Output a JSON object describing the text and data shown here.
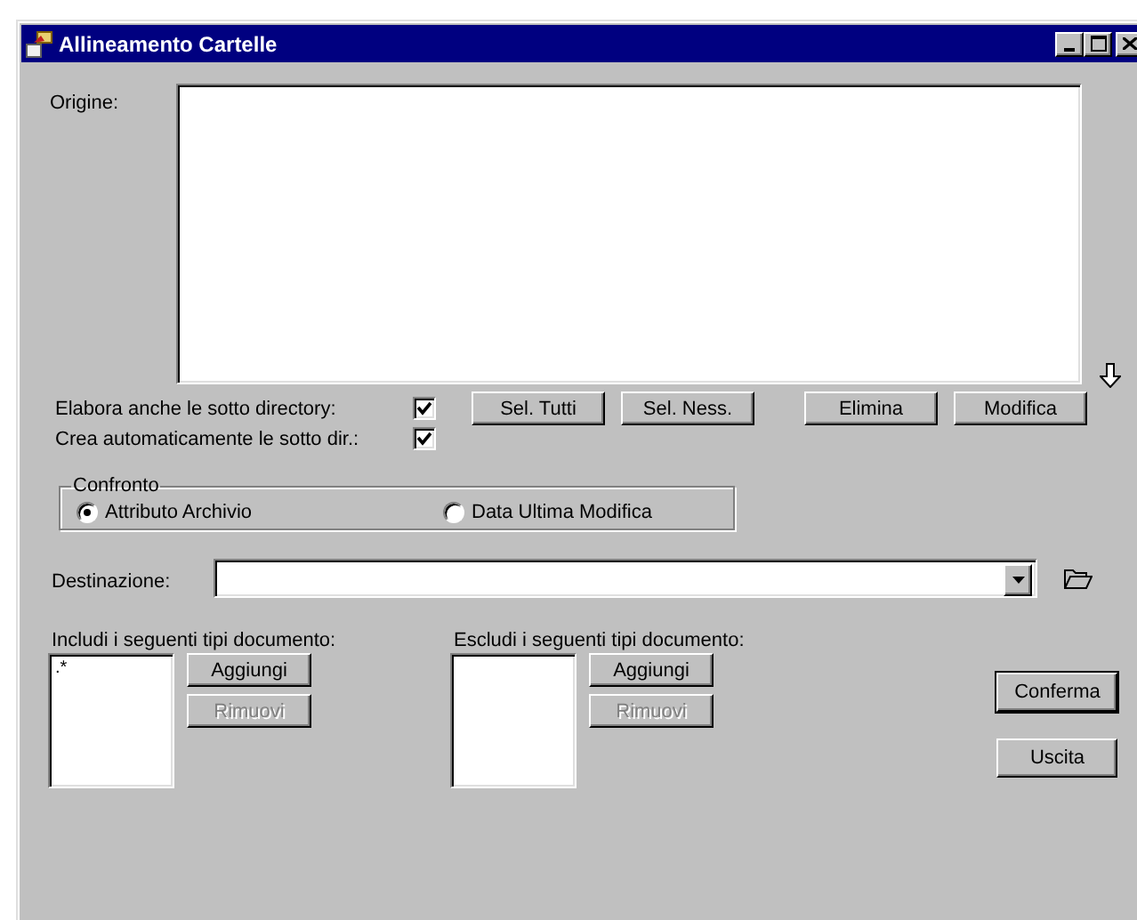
{
  "window": {
    "title": "Allineamento Cartelle"
  },
  "origin": {
    "label": "Origine:"
  },
  "options": [
    {
      "label": "Elabora anche le sotto directory:",
      "checked": true
    },
    {
      "label": "Crea automaticamente le sotto dir.:",
      "checked": true
    }
  ],
  "selection_buttons": [
    {
      "label": "Sel. Tutti"
    },
    {
      "label": "Sel. Ness."
    }
  ],
  "edit_buttons": [
    {
      "label": "Elimina"
    },
    {
      "label": "Modifica"
    }
  ],
  "compare": {
    "label": "Confronto",
    "options": [
      {
        "label": "Attributo Archivio",
        "selected": true
      },
      {
        "label": "Data Ultima Modifica",
        "selected": false
      }
    ]
  },
  "destination": {
    "label": "Destinazione:"
  },
  "include": {
    "label": "Includi i seguenti tipi documento:",
    "items": [
      ".*"
    ],
    "buttons": [
      {
        "label": "Aggiungi",
        "disabled": false
      },
      {
        "label": "Rimuovi",
        "disabled": true
      }
    ]
  },
  "exclude": {
    "label": "Escludi i seguenti tipi documento:",
    "buttons": [
      {
        "label": "Aggiungi",
        "disabled": false
      },
      {
        "label": "Rimuovi",
        "disabled": true
      }
    ]
  },
  "actions": [
    {
      "label": "Conferma",
      "default": true
    },
    {
      "label": "Uscita",
      "default": false
    }
  ]
}
